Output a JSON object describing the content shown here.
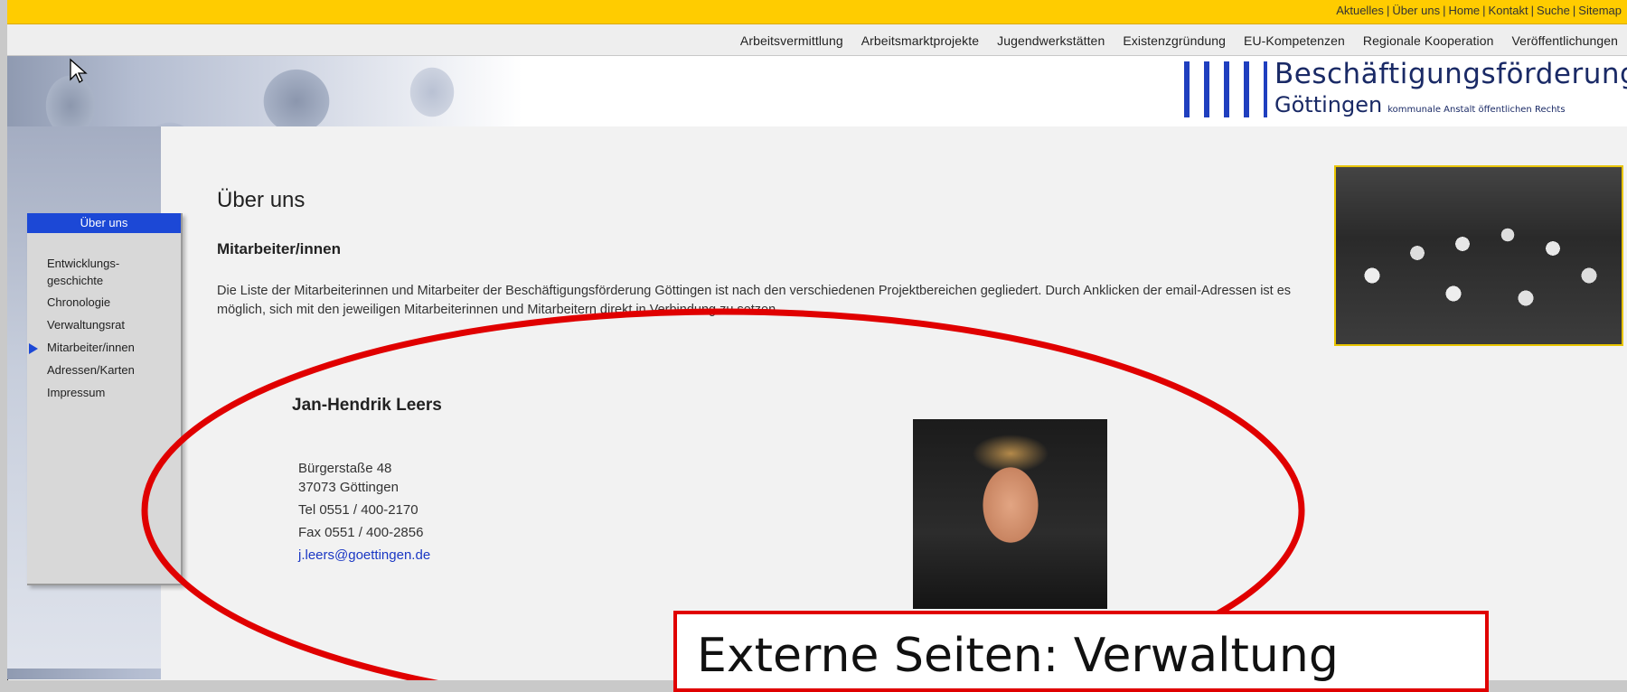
{
  "top_links": [
    "Aktuelles",
    "Über uns",
    "Home",
    "Kontakt",
    "Suche",
    "Sitemap"
  ],
  "top_links_separator": "|",
  "nav_links": [
    "Arbeitsvermittlung",
    "Arbeitsmarktprojekte",
    "Jugendwerkstätten",
    "Existenzgründung",
    "EU-Kompetenzen",
    "Regionale Kooperation",
    "Veröffentlichungen"
  ],
  "logo": {
    "brand": "Beschäftigungsförderung",
    "city": "Göttingen",
    "subtitle": "kommunale Anstalt öffentlichen Rechts"
  },
  "sidebar": {
    "header": "Über uns",
    "items": [
      {
        "label": "Entwicklungs-\ngeschichte"
      },
      {
        "label": "Chronologie"
      },
      {
        "label": "Verwaltungsrat"
      },
      {
        "label": "Mitarbeiter/innen"
      },
      {
        "label": "Adressen/Karten"
      },
      {
        "label": "Impressum"
      }
    ],
    "active_index": 3
  },
  "main": {
    "title": "Über uns",
    "subtitle": "Mitarbeiter/innen",
    "intro": "Die Liste der Mitarbeiterinnen und Mitarbeiter der Beschäftigungsförderung Göttingen ist nach den verschiedenen Projektbereichen gegliedert. Durch Anklicken der email-Adressen ist es möglich, sich mit den jeweiligen Mitarbeiterinnen und Mitarbeitern direkt in Verbindung zu setzen."
  },
  "contact": {
    "name": "Jan-Hendrik Leers",
    "street": "Bürgerstaße 48",
    "city": "37073 Göttingen",
    "tel": "Tel 0551 / 400-2170",
    "fax": "Fax 0551 / 400-2856",
    "email": "j.leers@goettingen.de"
  },
  "annotation": {
    "callout_text": "Externe Seiten: Verwaltung",
    "color": "#e00000"
  },
  "colors": {
    "topbar": "#ffcc00",
    "accent_blue": "#1c48d6",
    "link_blue": "#1a37c4"
  }
}
